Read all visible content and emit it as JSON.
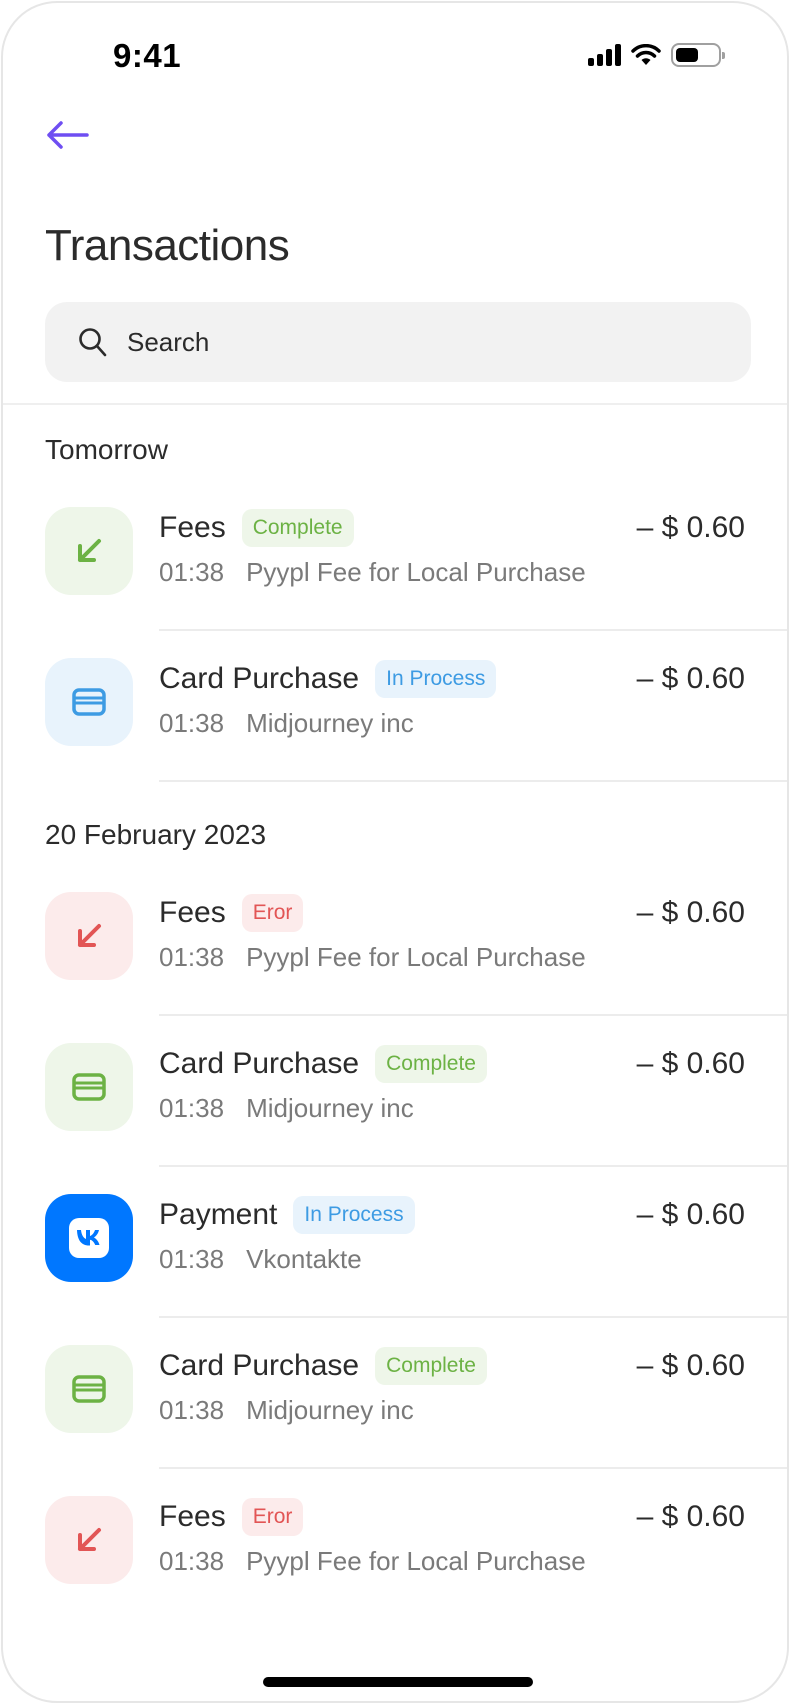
{
  "status_bar": {
    "time": "9:41",
    "icons": [
      "cellular-signal-icon",
      "wifi-icon",
      "battery-icon"
    ]
  },
  "header": {
    "back_icon": "arrow-left-icon",
    "title": "Transactions"
  },
  "search": {
    "icon": "search-icon",
    "placeholder": "Search",
    "value": ""
  },
  "colors": {
    "accent": "#6f4ef2",
    "complete_text": "#6cb244",
    "complete_bg": "#eef6e9",
    "in_process_text": "#3d9be3",
    "in_process_bg": "#e8f3fc",
    "error_text": "#e25555",
    "error_bg": "#fcebeb",
    "vk_blue": "#0077ff"
  },
  "sections": [
    {
      "label": "Tomorrow",
      "transactions": [
        {
          "title": "Fees",
          "status": "Complete",
          "status_type": "complete",
          "icon": "arrow-down-left-icon",
          "time": "01:38",
          "description": "Pyypl Fee for Local Purchase",
          "amount": "– $ 0.60"
        },
        {
          "title": "Card Purchase",
          "status": "In Process",
          "status_type": "in_process",
          "icon": "credit-card-icon",
          "time": "01:38",
          "description": "Midjourney inc",
          "amount": "– $ 0.60"
        }
      ]
    },
    {
      "label": "20 February 2023",
      "transactions": [
        {
          "title": "Fees",
          "status": "Eror",
          "status_type": "error",
          "icon": "arrow-down-left-icon",
          "time": "01:38",
          "description": "Pyypl Fee for Local Purchase",
          "amount": "– $ 0.60"
        },
        {
          "title": "Card Purchase",
          "status": "Complete",
          "status_type": "complete",
          "icon": "credit-card-icon",
          "time": "01:38",
          "description": "Midjourney inc",
          "amount": "– $ 0.60"
        },
        {
          "title": "Payment",
          "status": "In Process",
          "status_type": "in_process",
          "icon": "vk-logo-icon",
          "time": "01:38",
          "description": "Vkontakte",
          "amount": "– $ 0.60"
        },
        {
          "title": "Card Purchase",
          "status": "Complete",
          "status_type": "complete",
          "icon": "credit-card-icon",
          "time": "01:38",
          "description": "Midjourney inc",
          "amount": "– $ 0.60"
        },
        {
          "title": "Fees",
          "status": "Eror",
          "status_type": "error",
          "icon": "arrow-down-left-icon",
          "time": "01:38",
          "description": "Pyypl Fee for Local Purchase",
          "amount": "– $ 0.60"
        }
      ]
    }
  ]
}
